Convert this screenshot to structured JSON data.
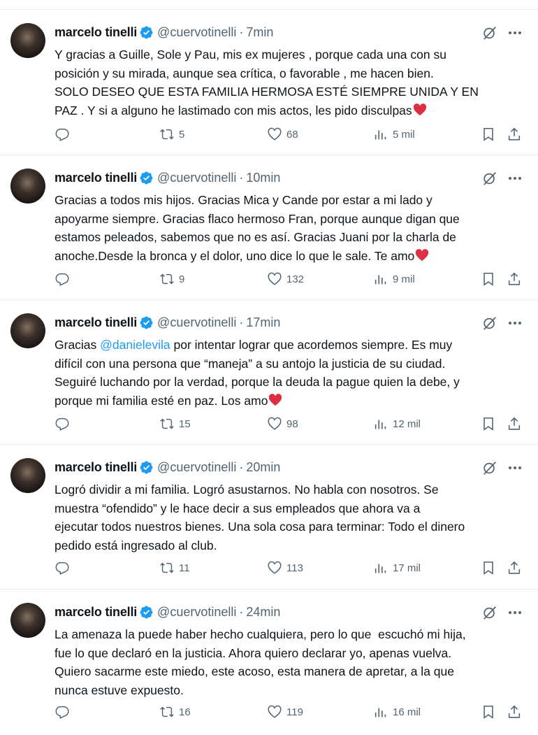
{
  "tweets": [
    {
      "author": "marcelo tinelli",
      "handle": "@cuervotinelli",
      "separator": "·",
      "time": "7min",
      "lines": [
        "Y gracias a Guille, Sole y Pau, mis ex mujeres , porque cada una con su",
        "posición y su mirada, aunque sea crítica, o favorable , me hacen bien.",
        "SOLO DESEO QUE ESTA FAMILIA HERMOSA ESTÉ SIEMPRE UNIDA Y EN",
        "PAZ . Y si a alguno he lastimado con mis actos, les pido disculpas"
      ],
      "replies": "",
      "retweets": "5",
      "likes": "68",
      "views": "5 mil"
    },
    {
      "author": "marcelo tinelli",
      "handle": "@cuervotinelli",
      "separator": "·",
      "time": "10min",
      "lines": [
        "Gracias a todos mis hijos. Gracias Mica y Cande por estar a mi lado y",
        "apoyarme siempre. Gracias flaco hermoso Fran, porque aunque digan que",
        "estamos peleados, sabemos que no es así. Gracias Juani por la charla de",
        "anoche.Desde la bronca y el dolor, uno dice lo que le sale. Te amo"
      ],
      "replies": "",
      "retweets": "9",
      "likes": "132",
      "views": "9 mil"
    },
    {
      "author": "marcelo tinelli",
      "handle": "@cuervotinelli",
      "separator": "·",
      "time": "17min",
      "lines_prefix": "Gracias ",
      "mention": "@danielevila",
      "lines_first_rest": " por intentar lograr que acordemos siempre. Es muy",
      "lines": [
        "difícil con una persona que “maneja” a su antojo la justicia de su ciudad.",
        "Seguiré luchando por la verdad, porque la deuda la pague quien la debe, y",
        "porque mi familia esté en paz. Los amo"
      ],
      "replies": "",
      "retweets": "15",
      "likes": "98",
      "views": "12 mil"
    },
    {
      "author": "marcelo tinelli",
      "handle": "@cuervotinelli",
      "separator": "·",
      "time": "20min",
      "lines": [
        "Logró dividir a mi familia. Logró asustarnos. No habla con nosotros. Se",
        "muestra “ofendido” y le hace decir a sus empleados que ahora va a",
        "ejecutar todos nuestros bienes. Una sola cosa para terminar: Todo el dinero",
        "pedido está ingresado al club."
      ],
      "replies": "",
      "retweets": "11",
      "likes": "113",
      "views": "17 mil"
    },
    {
      "author": "marcelo tinelli",
      "handle": "@cuervotinelli",
      "separator": "·",
      "time": "24min",
      "lines": [
        "La amenaza la puede haber hecho cualquiera, pero lo que  escuchó mi hija,",
        "fue lo que declaró en la justicia. Ahora quiero declarar yo, apenas vuelva.",
        "Quiero sacarme este miedo, este acoso, esta manera de apretar, a la que",
        "nunca estuve expuesto."
      ],
      "replies": "",
      "retweets": "16",
      "likes": "119",
      "views": "16 mil"
    }
  ],
  "colors": {
    "text": "#0f1419",
    "muted": "#536471",
    "link": "#1d9bf0",
    "verified": "#1d9bf0",
    "heart": "#f91880",
    "divider": "#e6e9eb"
  },
  "icons": [
    "verified-badge-icon",
    "grok-icon",
    "more-icon",
    "reply-icon",
    "retweet-icon",
    "like-icon",
    "views-icon",
    "bookmark-icon",
    "share-icon",
    "red-heart-emoji"
  ]
}
